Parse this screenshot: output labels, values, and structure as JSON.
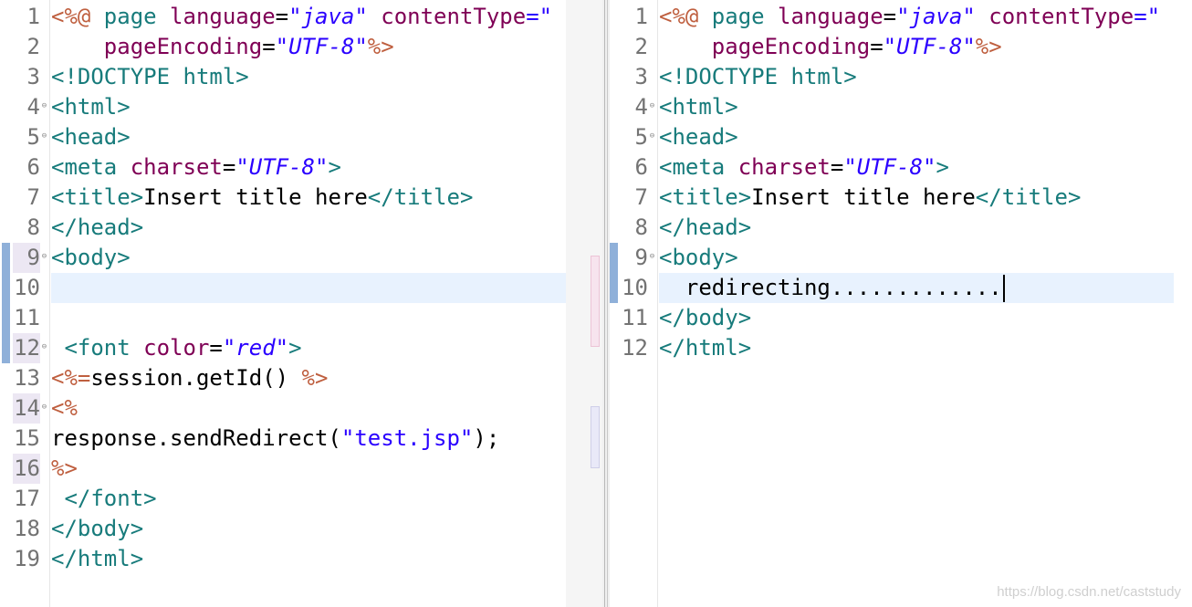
{
  "editor_left": {
    "line_numbers": [
      "1",
      "2",
      "3",
      "4",
      "5",
      "6",
      "7",
      "8",
      "9",
      "10",
      "11",
      "12",
      "13",
      "14",
      "15",
      "16",
      "17",
      "18",
      "19"
    ],
    "fold_markers": [
      "⊖",
      "⊖",
      "⊖",
      "⊖",
      "⊖"
    ],
    "lines": {
      "l1": {
        "a": "<%@ ",
        "b": "page ",
        "c": "language",
        "d": "=",
        "e": "\"java\"",
        "f": " ",
        "g": "contentType",
        "h": "=\""
      },
      "l2": {
        "a": "    ",
        "b": "pageEncoding",
        "c": "=",
        "d": "\"UTF-8\"",
        "e": "%>"
      },
      "l3": {
        "a": "<!DOCTYPE ",
        "b": "html",
        "c": ">"
      },
      "l4": {
        "a": "<html>"
      },
      "l5": {
        "a": "<head>"
      },
      "l6": {
        "a": "<meta ",
        "b": "charset",
        "c": "=",
        "d": "\"UTF-8\"",
        "e": ">"
      },
      "l7": {
        "a": "<title>",
        "b": "Insert title here",
        "c": "</title>"
      },
      "l8": {
        "a": "</head>"
      },
      "l9": {
        "a": "<body>"
      },
      "l12": {
        "a": " <font ",
        "b": "color",
        "c": "=",
        "d": "\"red\"",
        "e": ">"
      },
      "l13": {
        "a": "<%=",
        "b": "session.getId() ",
        "c": "%>"
      },
      "l14": {
        "a": "<%"
      },
      "l15": {
        "a": "response.sendRedirect(",
        "b": "\"test.jsp\"",
        "c": ");"
      },
      "l16": {
        "a": "%>"
      },
      "l17": {
        "a": " </font>"
      },
      "l18": {
        "a": "</body>"
      },
      "l19": {
        "a": "</html>"
      }
    }
  },
  "editor_right": {
    "line_numbers": [
      "1",
      "2",
      "3",
      "4",
      "5",
      "6",
      "7",
      "8",
      "9",
      "10",
      "11",
      "12"
    ],
    "fold_markers": [
      "⊖",
      "⊖",
      "⊖"
    ],
    "lines": {
      "l1": {
        "a": "<%@ ",
        "b": "page ",
        "c": "language",
        "d": "=",
        "e": "\"java\"",
        "f": " ",
        "g": "contentType",
        "h": "=\""
      },
      "l2": {
        "a": "    ",
        "b": "pageEncoding",
        "c": "=",
        "d": "\"UTF-8\"",
        "e": "%>"
      },
      "l3": {
        "a": "<!DOCTYPE ",
        "b": "html",
        "c": ">"
      },
      "l4": {
        "a": "<html>"
      },
      "l5": {
        "a": "<head>"
      },
      "l6": {
        "a": "<meta ",
        "b": "charset",
        "c": "=",
        "d": "\"UTF-8\"",
        "e": ">"
      },
      "l7": {
        "a": "<title>",
        "b": "Insert title here",
        "c": "</title>"
      },
      "l8": {
        "a": "</head>"
      },
      "l9": {
        "a": "<body>"
      },
      "l10": {
        "a": "  redirecting............."
      },
      "l11": {
        "a": "</body>"
      },
      "l12": {
        "a": "</html>"
      }
    }
  },
  "colors": {
    "tag": "#177b7b",
    "attribute": "#7f0055",
    "value": "#2a00ff",
    "jsp_delimiter": "#bf5f3f",
    "current_line": "#e8f2fe"
  },
  "watermark": "https://blog.csdn.net/caststudy"
}
